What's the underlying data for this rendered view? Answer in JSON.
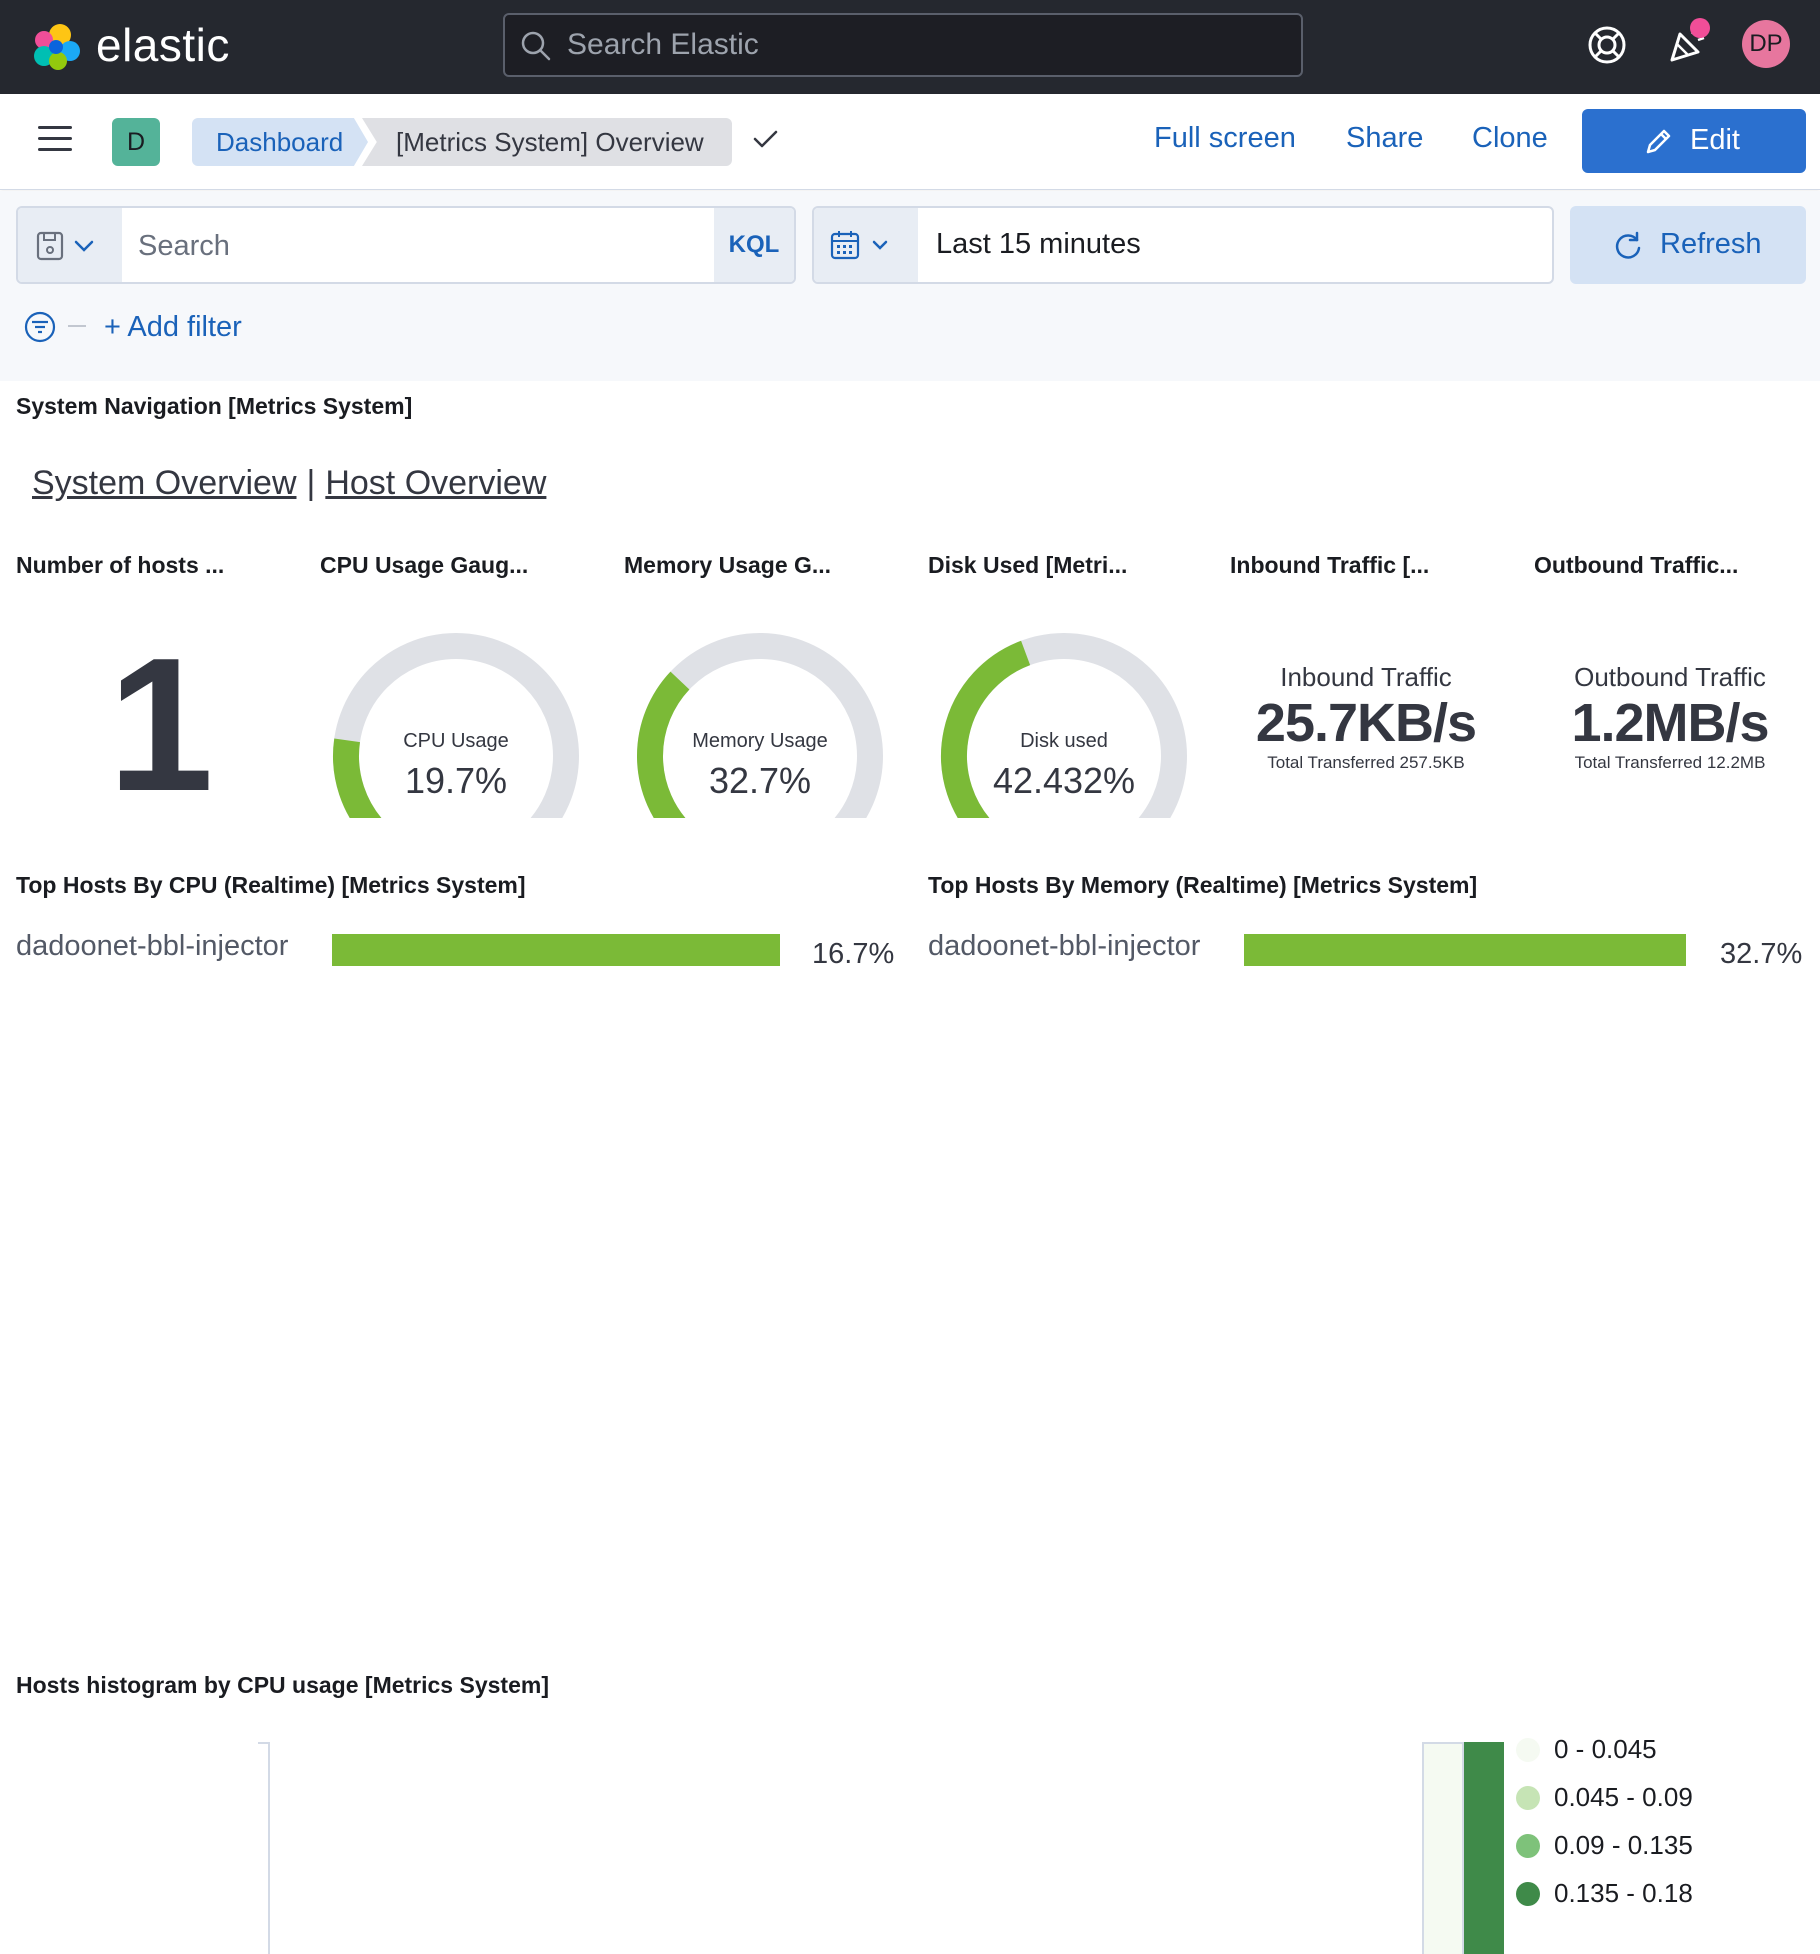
{
  "header": {
    "brand": "elastic",
    "search_placeholder": "Search Elastic",
    "avatar_initials": "DP"
  },
  "subheader": {
    "space_initial": "D",
    "breadcrumbs": [
      "Dashboard",
      "[Metrics System] Overview"
    ],
    "links": [
      "Full screen",
      "Share",
      "Clone"
    ],
    "edit_label": "Edit"
  },
  "query": {
    "search_placeholder": "Search",
    "language": "KQL",
    "time_range": "Last 15 minutes",
    "refresh_label": "Refresh",
    "add_filter_label": "+ Add filter"
  },
  "navigation_panel": {
    "title": "System Navigation [Metrics System]",
    "links": [
      "System Overview",
      "Host Overview"
    ],
    "separator": "|"
  },
  "metric_panels": {
    "hosts": {
      "title": "Number of hosts ...",
      "value": "1"
    },
    "cpu": {
      "title": "CPU Usage Gaug...",
      "label": "CPU Usage",
      "value": "19.7%",
      "fraction": 0.197
    },
    "memory": {
      "title": "Memory Usage G...",
      "label": "Memory Usage",
      "value": "32.7%",
      "fraction": 0.327
    },
    "disk": {
      "title": "Disk Used [Metri...",
      "label": "Disk used",
      "value": "42.432%",
      "fraction": 0.42432
    },
    "inbound": {
      "title": "Inbound Traffic [...",
      "label": "Inbound Traffic",
      "value": "25.7KB/s",
      "total": "Total Transferred 257.5KB"
    },
    "outbound": {
      "title": "Outbound Traffic...",
      "label": "Outbound Traffic",
      "value": "1.2MB/s",
      "total": "Total Transferred 12.2MB"
    }
  },
  "top_hosts_cpu": {
    "title": "Top Hosts By CPU (Realtime) [Metrics System]",
    "host": "dadoonet-bbl-injector",
    "value": "16.7%"
  },
  "top_hosts_memory": {
    "title": "Top Hosts By Memory (Realtime) [Metrics System]",
    "host": "dadoonet-bbl-injector",
    "value": "32.7%"
  },
  "histogram": {
    "title": "Hosts histogram by CPU usage [Metrics System]",
    "legend": [
      {
        "label": "0 - 0.045",
        "color": "#f5faf2"
      },
      {
        "label": "0.045 - 0.09",
        "color": "#c6e4b5"
      },
      {
        "label": "0.09 - 0.135",
        "color": "#7ec27a"
      },
      {
        "label": "0.135 - 0.18",
        "color": "#3f8a49"
      }
    ]
  },
  "colors": {
    "gauge_fill": "#7bba37",
    "gauge_track": "#dfe1e6",
    "link": "#1a62b9",
    "primary_button": "#2b70cf"
  }
}
